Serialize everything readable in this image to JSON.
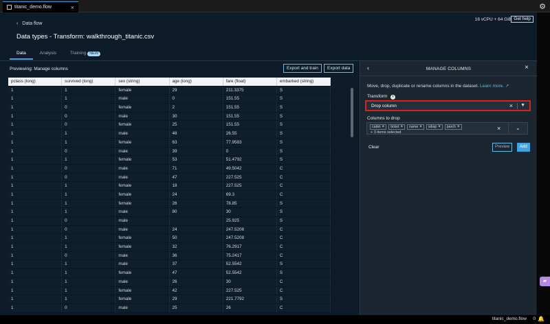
{
  "window": {
    "file_tab": "titanic_demo.flow",
    "tab_close": "×",
    "settings_glyph": "⚙"
  },
  "header": {
    "back_label": "Data flow",
    "back_glyph": "‹",
    "title": "Data types - Transform: walkthrough_titanic.csv",
    "resources": "16 vCPU + 64 GiB",
    "help_label": "Get help"
  },
  "tabs": [
    {
      "label": "Data",
      "active": true
    },
    {
      "label": "Analysis",
      "active": false
    },
    {
      "label": "Training",
      "active": false,
      "badge": "NEW"
    }
  ],
  "preview": {
    "label": "Previewing: Manage columns",
    "export_train_label": "Export and train",
    "export_data_label": "Export data"
  },
  "table": {
    "columns": [
      "pclass (long)",
      "survived (long)",
      "sex (string)",
      "age (long)",
      "fare (float)",
      "embarked (string)"
    ],
    "rows": [
      [
        "1",
        "1",
        "female",
        "29",
        "211.3375",
        "S"
      ],
      [
        "1",
        "1",
        "male",
        "0",
        "151.55",
        "S"
      ],
      [
        "1",
        "0",
        "female",
        "2",
        "151.55",
        "S"
      ],
      [
        "1",
        "0",
        "male",
        "30",
        "151.55",
        "S"
      ],
      [
        "1",
        "0",
        "female",
        "25",
        "151.55",
        "S"
      ],
      [
        "1",
        "1",
        "male",
        "48",
        "26.55",
        "S"
      ],
      [
        "1",
        "1",
        "female",
        "63",
        "77.9583",
        "S"
      ],
      [
        "1",
        "0",
        "male",
        "39",
        "0",
        "S"
      ],
      [
        "1",
        "1",
        "female",
        "53",
        "51.4792",
        "S"
      ],
      [
        "1",
        "0",
        "male",
        "71",
        "49.5042",
        "C"
      ],
      [
        "1",
        "0",
        "male",
        "47",
        "227.525",
        "C"
      ],
      [
        "1",
        "1",
        "female",
        "18",
        "227.525",
        "C"
      ],
      [
        "1",
        "1",
        "female",
        "24",
        "69.3",
        "C"
      ],
      [
        "1",
        "1",
        "female",
        "26",
        "78.85",
        "S"
      ],
      [
        "1",
        "1",
        "male",
        "80",
        "30",
        "S"
      ],
      [
        "1",
        "0",
        "male",
        "",
        "25.925",
        "S"
      ],
      [
        "1",
        "0",
        "male",
        "24",
        "247.5208",
        "C"
      ],
      [
        "1",
        "1",
        "female",
        "50",
        "247.5208",
        "C"
      ],
      [
        "1",
        "1",
        "female",
        "32",
        "76.2917",
        "C"
      ],
      [
        "1",
        "0",
        "male",
        "36",
        "75.2417",
        "C"
      ],
      [
        "1",
        "1",
        "male",
        "37",
        "52.5542",
        "S"
      ],
      [
        "1",
        "1",
        "female",
        "47",
        "52.5542",
        "S"
      ],
      [
        "1",
        "1",
        "male",
        "26",
        "30",
        "C"
      ],
      [
        "1",
        "1",
        "female",
        "42",
        "227.525",
        "C"
      ],
      [
        "1",
        "1",
        "female",
        "29",
        "221.7792",
        "S"
      ],
      [
        "1",
        "0",
        "male",
        "25",
        "26",
        "C"
      ]
    ]
  },
  "panel": {
    "back_glyph": "‹",
    "title": "MANAGE COLUMNS",
    "close_glyph": "×",
    "description": "Move, drop, duplicate or rename columns in the dataset.",
    "learn_more": "Learn more.",
    "transform_label": "Transform",
    "info_glyph": "i",
    "transform_value": "Drop column",
    "clear_glyph": "×",
    "dropdown_glyph": "▼",
    "columns_label": "Columns to drop",
    "chips": [
      "cabin",
      "ticket",
      "name",
      "sibsp",
      "parch"
    ],
    "chip_remove_glyph": "×",
    "more_selected": "+ 3 items selected",
    "multi_clear_glyph": "×",
    "multi_dropdown_glyph": "⌄",
    "clear_label": "Clear",
    "preview_label": "Preview",
    "add_label": "Add"
  },
  "status": {
    "file": "titanic_demo.flow",
    "count": "0",
    "bell_glyph": "🔔"
  },
  "colors": {
    "accent": "#41a3dd",
    "highlight_border": "#e21d1d",
    "chat_button": "#b587e6"
  }
}
